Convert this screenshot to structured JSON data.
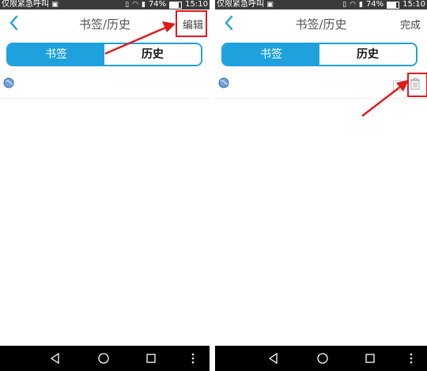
{
  "status_bar": {
    "left_text": "仅限紧急呼叫",
    "battery": "74%",
    "time": "15:10",
    "battery_level": 0.74
  },
  "left_screen": {
    "title": "书签/历史",
    "action_label": "编辑",
    "tabs": [
      {
        "label": "书签",
        "active": true
      },
      {
        "label": "历史",
        "active": false
      }
    ]
  },
  "right_screen": {
    "title": "书签/历史",
    "action_label": "完成",
    "tabs": [
      {
        "label": "书签",
        "active": true
      },
      {
        "label": "历史",
        "active": false
      }
    ]
  },
  "colors": {
    "accent": "#1ea1dd",
    "highlight": "#e01a1a",
    "status_bar": "#3a3a3a",
    "nav_bar": "#000000"
  },
  "icons": {
    "back": "chevron-left-icon",
    "row": "globe-icon",
    "delete": "trash-icon",
    "nav_back": "triangle-back-icon",
    "nav_home": "circle-home-icon",
    "nav_recent": "square-recent-icon",
    "nav_menu": "vertical-dots-icon"
  }
}
